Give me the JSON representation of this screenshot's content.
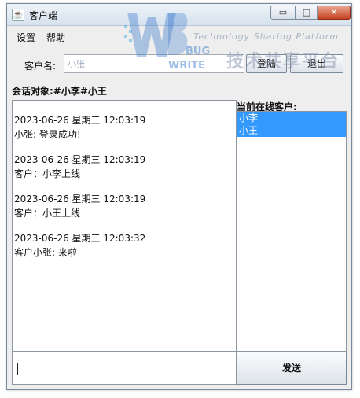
{
  "window": {
    "title": "客户端",
    "icon": "java-app-icon"
  },
  "title_buttons": {
    "minimize": "▭",
    "maximize": "□",
    "close": "✕"
  },
  "menu": [
    "设置",
    "帮助"
  ],
  "login": {
    "client_label": "客户名:",
    "client_value": "小张",
    "login_button": "登陆",
    "exit_button": "退出"
  },
  "session": {
    "label": "会话对象:#小李#小王"
  },
  "online": {
    "label": "当前在线客户:",
    "clients": [
      "小李",
      "小王"
    ]
  },
  "messages": [
    {
      "time": "2023-06-26 星期三 12:03:19",
      "text": "小张: 登录成功!"
    },
    {
      "time": "2023-06-26 星期三 12:03:19",
      "text": "客户：小李上线"
    },
    {
      "time": "2023-06-26 星期三 12:03:19",
      "text": "客户：小王上线"
    },
    {
      "time": "2023-06-26 星期三 12:03:32",
      "text": "客户小张: 来啦"
    }
  ],
  "send": {
    "input_value": "",
    "button": "发送"
  },
  "watermark": {
    "bug": "BUG",
    "write": "WRITE",
    "tagline": "Technology Sharing Platform",
    "chinese": "技术共享平台"
  },
  "colors": {
    "selection": "#3399ff",
    "close_button": "#c5401f"
  }
}
